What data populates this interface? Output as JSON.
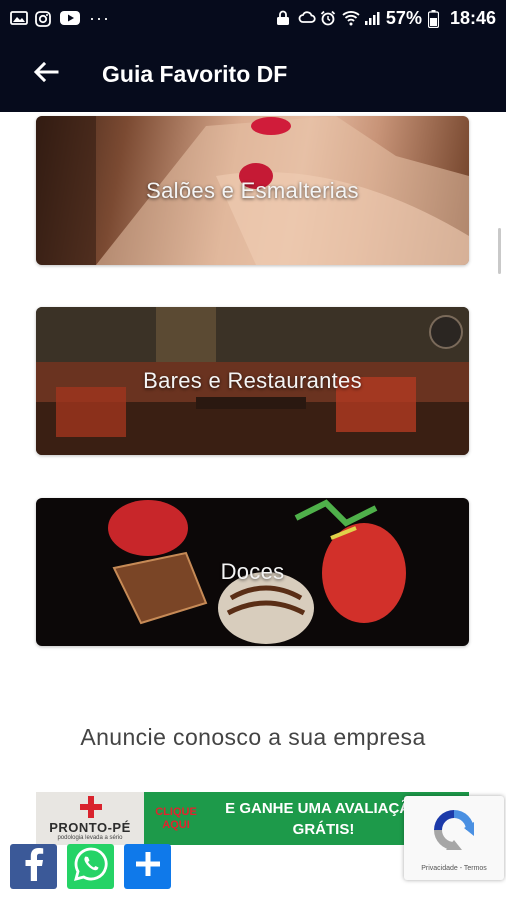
{
  "status_bar": {
    "icons_left": [
      "gallery-icon",
      "instagram-icon",
      "youtube-icon"
    ],
    "more": "···",
    "icons_right": [
      "lock-icon",
      "cloud-icon",
      "alarm-icon",
      "wifi-icon",
      "signal-icon",
      "battery-icon"
    ],
    "battery": "57%",
    "time": "18:46"
  },
  "app_bar": {
    "title": "Guia Favorito DF"
  },
  "categories": [
    {
      "label": "Salões e Esmalterias"
    },
    {
      "label": "Bares e Restaurantes"
    },
    {
      "label": "Doces"
    }
  ],
  "promo": {
    "text": "Anuncie conosco a sua empresa"
  },
  "ad": {
    "logo": "PRONTO-PÉ",
    "logo_sub": "podologia levada a sério",
    "click_line1": "CLIQUE",
    "click_line2": "AQUI",
    "offer_line1": "E GANHE UMA AVALIAÇÃO",
    "offer_line2": "GRÁTIS!"
  },
  "recaptcha": {
    "links": "Privacidade - Termos"
  },
  "share": {
    "facebook": "facebook-icon",
    "whatsapp": "whatsapp-icon",
    "more": "plus-icon"
  },
  "colors": {
    "bar_background": "#060b1c",
    "facebook": "#3b5998",
    "whatsapp": "#25d366",
    "share_more": "#0f79ea",
    "ad_green": "#1d9a4a"
  }
}
